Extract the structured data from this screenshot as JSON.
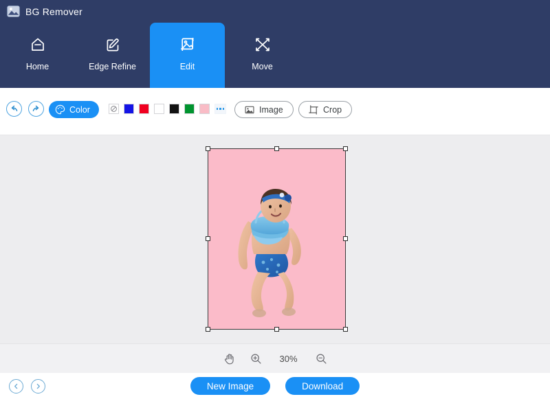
{
  "app": {
    "title": "BG Remover",
    "logo_icon": "image-photo-icon",
    "header_color": "#2F3D66",
    "accent_color": "#1A90F5"
  },
  "nav": {
    "items": [
      {
        "label": "Home",
        "icon": "home-icon",
        "active": false
      },
      {
        "label": "Edge Refine",
        "icon": "pen-square-icon",
        "active": false
      },
      {
        "label": "Edit",
        "icon": "picture-frame-icon",
        "active": true
      },
      {
        "label": "Move",
        "icon": "move-arrows-icon",
        "active": false
      }
    ]
  },
  "toolbar": {
    "undo_icon": "undo-arrow-icon",
    "redo_icon": "redo-arrow-icon",
    "color_button": {
      "label": "Color",
      "icon": "palette-icon"
    },
    "swatches": [
      {
        "name": "none",
        "color": "transparent",
        "icon": "no-color-icon"
      },
      {
        "name": "blue",
        "color": "#1414E6"
      },
      {
        "name": "red",
        "color": "#F00020"
      },
      {
        "name": "white",
        "color": "#FFFFFF"
      },
      {
        "name": "black",
        "color": "#121212"
      },
      {
        "name": "green",
        "color": "#00942F"
      },
      {
        "name": "pink",
        "color": "#F9BCC6"
      }
    ],
    "more_colors": {
      "name": "more-colors",
      "icon": "ellipsis-icon"
    },
    "image_button": {
      "label": "Image",
      "icon": "image-icon"
    },
    "crop_button": {
      "label": "Crop",
      "icon": "crop-icon"
    }
  },
  "canvas": {
    "background_color": "#EDEDEF",
    "artboard": {
      "fill_color": "#FBBBC9",
      "subject_alt": "toddler in blue swimsuit"
    }
  },
  "zoombar": {
    "hand_icon": "hand-tool-icon",
    "zoom_in_icon": "zoom-in-icon",
    "zoom_out_icon": "zoom-out-icon",
    "zoom_level": "30%"
  },
  "footer": {
    "prev_icon": "chevron-left-icon",
    "next_icon": "chevron-right-icon",
    "new_image_label": "New Image",
    "download_label": "Download"
  }
}
